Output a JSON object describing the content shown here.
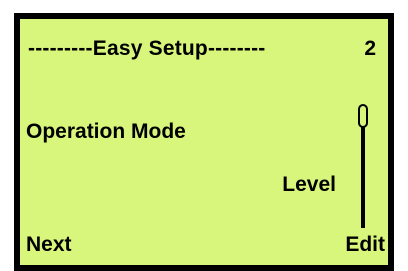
{
  "colors": {
    "screen_background": "#d8f57c",
    "frame": "#000000",
    "text": "#000000"
  },
  "header": {
    "title": "---------Easy Setup--------",
    "page_number": "2"
  },
  "main": {
    "setting_label": "Operation Mode",
    "setting_value": "Level"
  },
  "footer": {
    "left_softkey": "Next",
    "right_softkey": "Edit"
  },
  "scrollbar": {
    "position_fraction": 0.0
  }
}
